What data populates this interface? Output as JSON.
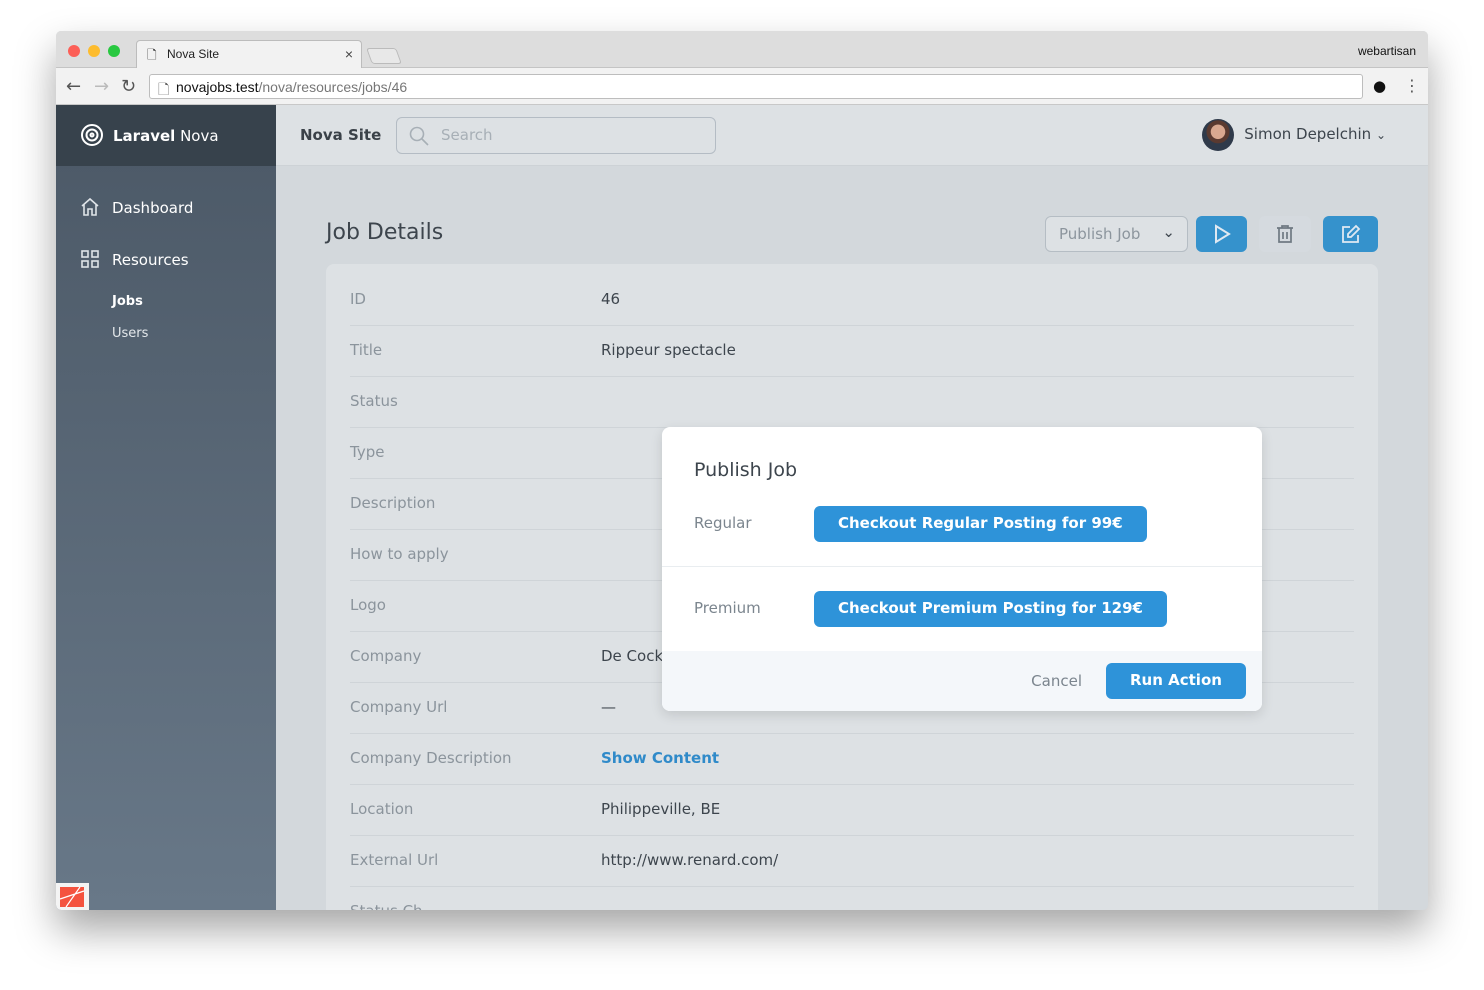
{
  "browser": {
    "tab_title": "Nova Site",
    "profile": "webartisan",
    "url_host": "novajobs.test",
    "url_path": "/nova/resources/jobs/46"
  },
  "sidebar": {
    "brand_bold": "Laravel",
    "brand_rest": " Nova",
    "items": [
      {
        "label": "Dashboard",
        "icon": "home-icon"
      },
      {
        "label": "Resources",
        "icon": "grid-icon"
      }
    ],
    "sub_items": [
      {
        "label": "Jobs",
        "active": true
      },
      {
        "label": "Users",
        "active": false
      }
    ]
  },
  "header": {
    "site": "Nova Site",
    "search_placeholder": "Search",
    "user": "Simon Depelchin"
  },
  "page": {
    "title": "Job Details",
    "action_select": "Publish Job"
  },
  "fields": [
    {
      "label": "ID",
      "value": "46"
    },
    {
      "label": "Title",
      "value": "Rippeur spectacle"
    },
    {
      "label": "Status",
      "value": ""
    },
    {
      "label": "Type",
      "value": ""
    },
    {
      "label": "Description",
      "value": ""
    },
    {
      "label": "How to apply",
      "value": ""
    },
    {
      "label": "Logo",
      "value": ""
    },
    {
      "label": "Company",
      "value": "De Cock"
    },
    {
      "label": "Company Url",
      "value": "—"
    },
    {
      "label": "Company Description",
      "value": "Show Content",
      "link": true
    },
    {
      "label": "Location",
      "value": "Philippeville, BE"
    },
    {
      "label": "External Url",
      "value": "http://www.renard.com/"
    },
    {
      "label": "Status Ch",
      "value": ""
    }
  ],
  "modal": {
    "title": "Publish Job",
    "regular_label": "Regular",
    "regular_button": "Checkout Regular Posting for 99€",
    "premium_label": "Premium",
    "premium_button": "Checkout Premium Posting for 129€",
    "cancel": "Cancel",
    "run": "Run Action"
  },
  "colors": {
    "primary": "#2e93d9",
    "sidebar": "#4b5866"
  }
}
